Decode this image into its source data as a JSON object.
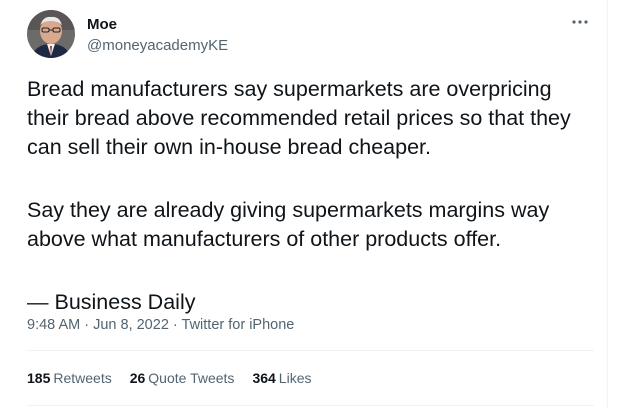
{
  "author": {
    "display_name": "Moe",
    "handle": "@moneyacademyKE"
  },
  "tweet": {
    "paragraph_1": "Bread manufacturers say supermarkets are overpricing their bread above recommended retail prices so that they can sell their own in-house bread cheaper.",
    "paragraph_2": "Say they are already giving supermarkets margins way above what manufacturers of other products offer.",
    "attribution": "— Business Daily"
  },
  "meta": {
    "time": "9:48 AM",
    "separator_1": " · ",
    "date": "Jun 8, 2022",
    "separator_2": " · ",
    "source": "Twitter for iPhone"
  },
  "stats": {
    "retweets_count": "185",
    "retweets_label": "Retweets",
    "quotes_count": "26",
    "quotes_label": "Quote Tweets",
    "likes_count": "364",
    "likes_label": "Likes"
  },
  "icons": {
    "more": "more-horizontal-icon"
  },
  "colors": {
    "text": "#0f1419",
    "secondary": "#536471",
    "border": "#eff3f4"
  }
}
